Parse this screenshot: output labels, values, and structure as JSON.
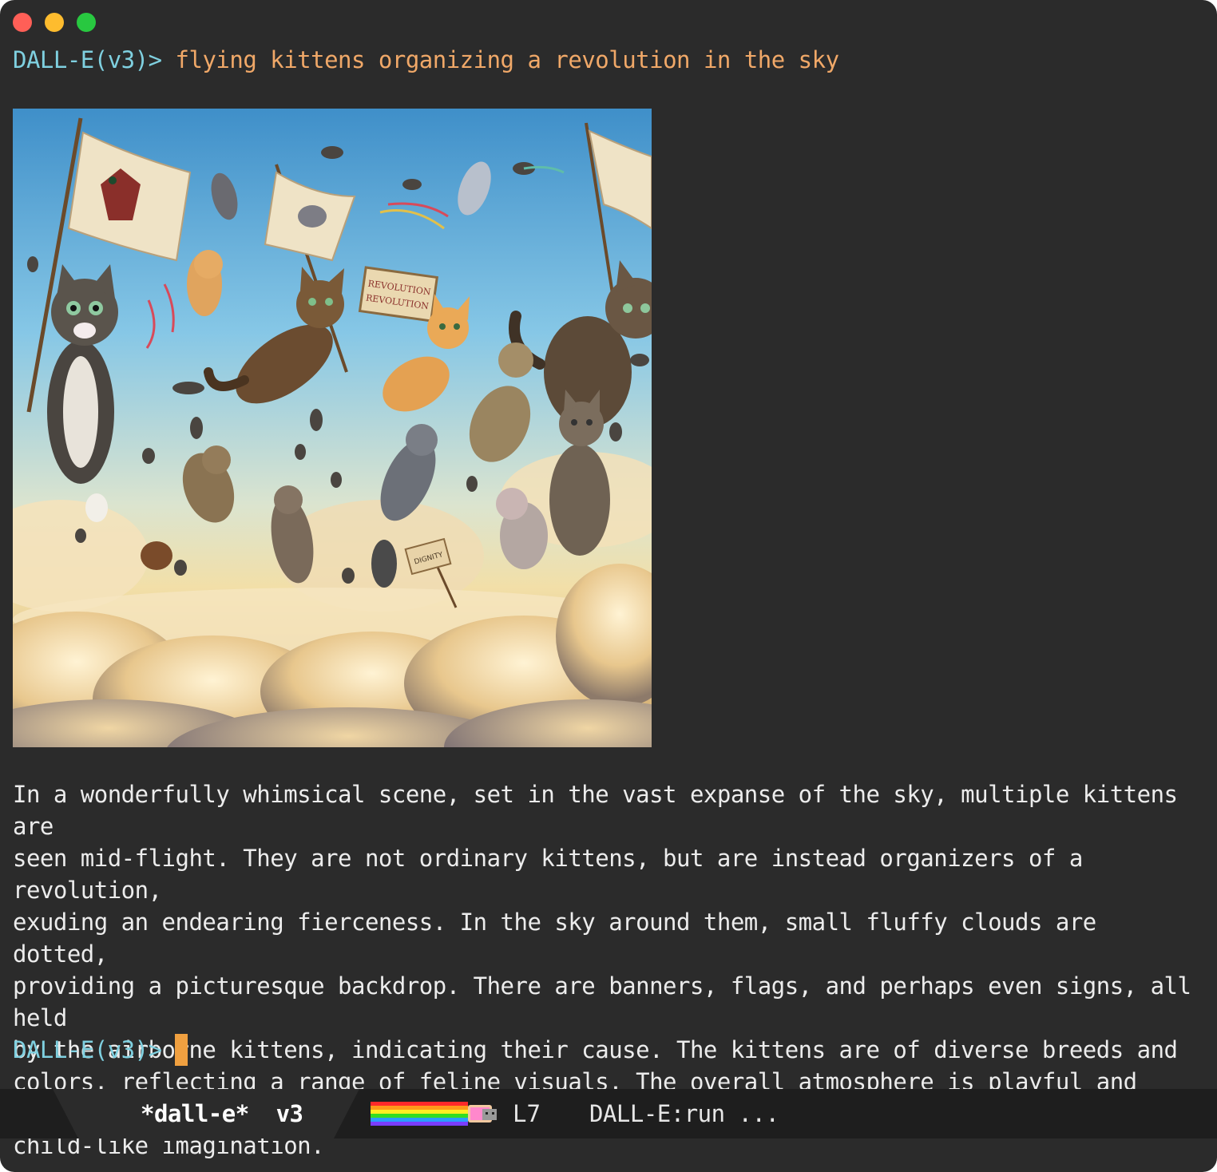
{
  "window": {
    "controls": [
      "close",
      "minimize",
      "maximize"
    ]
  },
  "terminal": {
    "prompt": "DALL-E(v3)>",
    "command": "flying kittens organizing a revolution in the sky",
    "image": {
      "subject": "flying kittens organizing a revolution in the sky",
      "banner_text": [
        "REVOLUTION",
        "REVOLUTION"
      ],
      "sign_text": [
        "DIGNITY"
      ]
    },
    "response": "In a wonderfully whimsical scene, set in the vast expanse of the sky, multiple kittens are\nseen mid-flight. They are not ordinary kittens, but are instead organizers of a revolution,\nexuding an endearing fierceness. In the sky around them, small fluffy clouds are dotted,\nproviding a picturesque backdrop. There are banners, flags, and perhaps even signs, all held\nby the airborne kittens, indicating their cause. The kittens are of diverse breeds and\ncolors, reflecting a range of feline visuals. The overall atmosphere is playful and full of\nchild-like imagination.",
    "next_prompt": "DALL-E(v3)>"
  },
  "modeline": {
    "buffer_name": "*dall-e*  v3",
    "progress_indicator": "nyan-cat-icon",
    "line_number": "L7",
    "mode": "DALL-E:run ..."
  },
  "colors": {
    "background": "#2b2b2b",
    "prompt": "#7fd0e0",
    "command": "#f0a868",
    "text": "#ececec",
    "cursor": "#f0a040",
    "modeline_bg": "#1e1e1e",
    "modeline_tab": "#2b2b2b"
  }
}
